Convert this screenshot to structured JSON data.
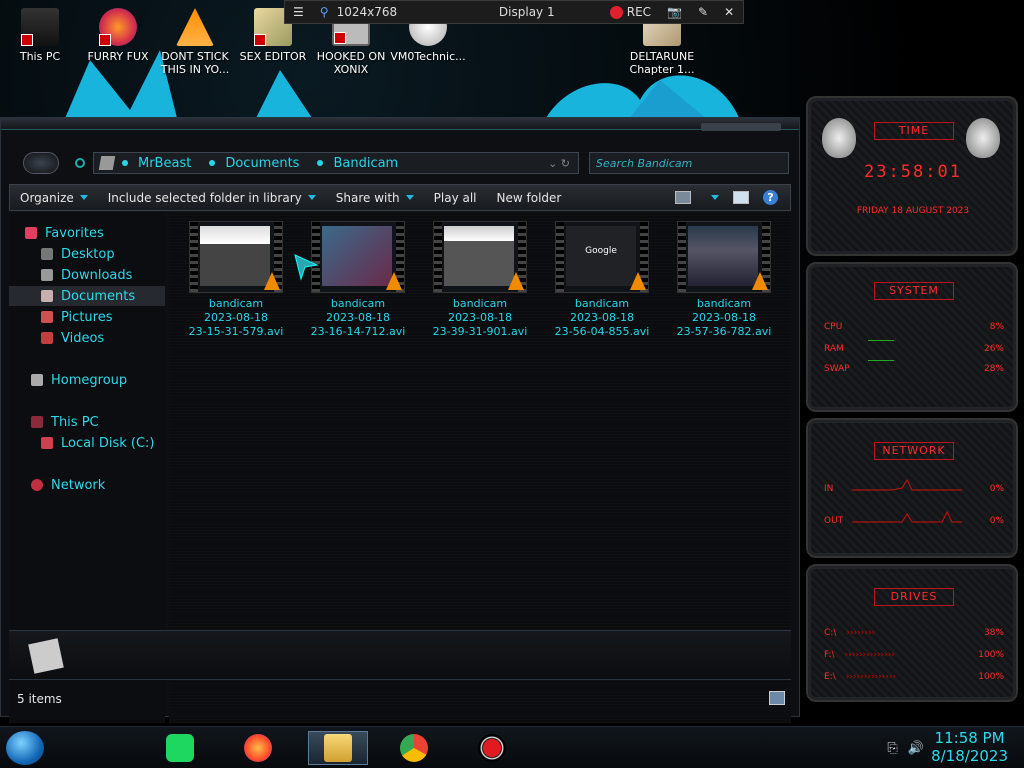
{
  "desktop": {
    "icons": [
      {
        "label": "This PC"
      },
      {
        "label": "FURRY FUX"
      },
      {
        "label": "DONT STICK\nTHIS IN YO..."
      },
      {
        "label": "SEX EDITOR"
      },
      {
        "label": "HOOKED ON\nXONIX"
      },
      {
        "label": "VM0Technic..."
      },
      {
        "label": "DELTARUNE\nChapter 1..."
      }
    ]
  },
  "recorder": {
    "resolution": "1024x768",
    "display": "Display 1",
    "rec_label": "REC"
  },
  "explorer": {
    "breadcrumb": [
      "MrBeast",
      "Documents",
      "Bandicam"
    ],
    "search_placeholder": "Search Bandicam",
    "toolbar": {
      "organize": "Organize",
      "include": "Include selected folder in library",
      "share": "Share with",
      "play_all": "Play all",
      "new_folder": "New folder"
    },
    "nav": {
      "favorites": "Favorites",
      "desktop": "Desktop",
      "downloads": "Downloads",
      "documents": "Documents",
      "pictures": "Pictures",
      "videos": "Videos",
      "homegroup": "Homegroup",
      "this_pc": "This PC",
      "local_disk": "Local Disk (C:)",
      "network": "Network"
    },
    "files": [
      {
        "name1": "bandicam",
        "name2": "2023-08-18",
        "name3": "23-15-31-579.avi"
      },
      {
        "name1": "bandicam",
        "name2": "2023-08-18",
        "name3": "23-16-14-712.avi"
      },
      {
        "name1": "bandicam",
        "name2": "2023-08-18",
        "name3": "23-39-31-901.avi"
      },
      {
        "name1": "bandicam",
        "name2": "2023-08-18",
        "name3": "23-56-04-855.avi",
        "thumb_text": "Google"
      },
      {
        "name1": "bandicam",
        "name2": "2023-08-18",
        "name3": "23-57-36-782.avi"
      }
    ],
    "status": "5 items"
  },
  "gadgets": {
    "time": {
      "title": "TIME",
      "clock": "23:58:01",
      "date": "FRIDAY 18 AUGUST 2023"
    },
    "system": {
      "title": "SYSTEM",
      "cpu_label": "CPU",
      "cpu_val": "8%",
      "ram_label": "RAM",
      "ram_val": "26%",
      "swap_label": "SWAP",
      "swap_val": "28%"
    },
    "network": {
      "title": "NETWORK",
      "in_label": "IN",
      "in_val": "0%",
      "out_label": "OUT",
      "out_val": "0%"
    },
    "drives": {
      "title": "DRIVES",
      "c_label": "C:\\",
      "c_val": "38%",
      "f_label": "F:\\",
      "f_val": "100%",
      "e_label": "E:\\",
      "e_val": "100%"
    }
  },
  "taskbar": {
    "time": "11:58 PM",
    "date": "8/18/2023"
  },
  "colors": {
    "accent_cyan": "#27d6e8",
    "gadget_red": "#ff2a2a",
    "rec_red": "#e0202c"
  }
}
